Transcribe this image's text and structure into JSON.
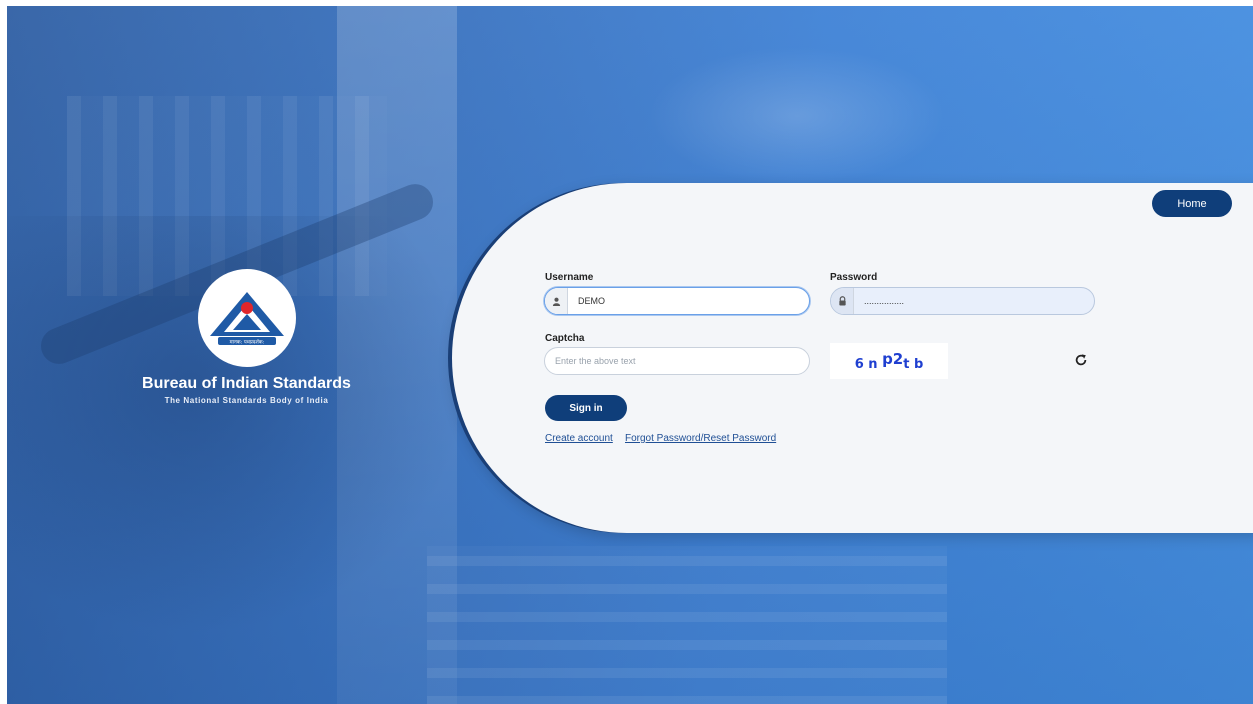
{
  "brand": {
    "title": "Bureau of Indian Standards",
    "subtitle": "The National Standards Body of India",
    "logo_text": "मानक: पथप्रदर्शक:",
    "logo_icon": "bis-logo-icon"
  },
  "header": {
    "home_label": "Home"
  },
  "form": {
    "username_label": "Username",
    "username_value": "DEMO",
    "username_icon": "user-icon",
    "password_label": "Password",
    "password_value": "................",
    "password_icon": "lock-icon",
    "captcha_label": "Captcha",
    "captcha_placeholder": "Enter the above text",
    "captcha_pre": "6 n ",
    "captcha_big": "p2",
    "captcha_post": "t b",
    "refresh_icon": "refresh-icon",
    "signin_label": "Sign in",
    "create_account_label": "Create account",
    "forgot_label": "Forgot Password/Reset Password"
  },
  "colors": {
    "primary": "#0f3e7a",
    "background_blue": "#3f82d6",
    "captcha": "#1f3fd0",
    "logo_red": "#e0262b"
  }
}
